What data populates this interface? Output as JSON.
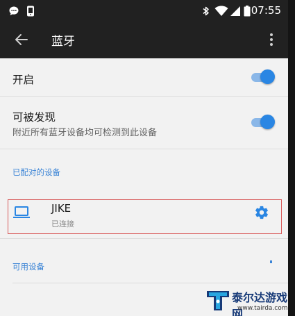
{
  "status_bar": {
    "time": "07:55",
    "icons": [
      "chat-icon",
      "phone-icon",
      "bluetooth-icon",
      "wifi-icon",
      "signal-icon",
      "battery-icon"
    ]
  },
  "app_bar": {
    "title": "蓝牙",
    "back_icon": "arrow-back-icon",
    "menu_icon": "more-vert-icon"
  },
  "settings": {
    "enable": {
      "label": "开启",
      "toggle_on": true
    },
    "discoverable": {
      "label": "可被发现",
      "description": "附近所有蓝牙设备均可检测到此设备",
      "toggle_on": true
    }
  },
  "paired_section": {
    "header": "已配对的设备",
    "devices": [
      {
        "name": "JIKE",
        "status": "已连接",
        "icon": "laptop-icon",
        "settings_icon": "gear-icon"
      }
    ]
  },
  "available_section": {
    "header": "可用设备"
  },
  "watermark": {
    "brand": "泰尔达游戏网",
    "url": "www.tairda.com"
  },
  "colors": {
    "accent": "#2a86e3",
    "section_text": "#3b84d6",
    "app_bar": "#212121",
    "background": "#f2f2f2",
    "highlight_border": "#d85a5a"
  }
}
